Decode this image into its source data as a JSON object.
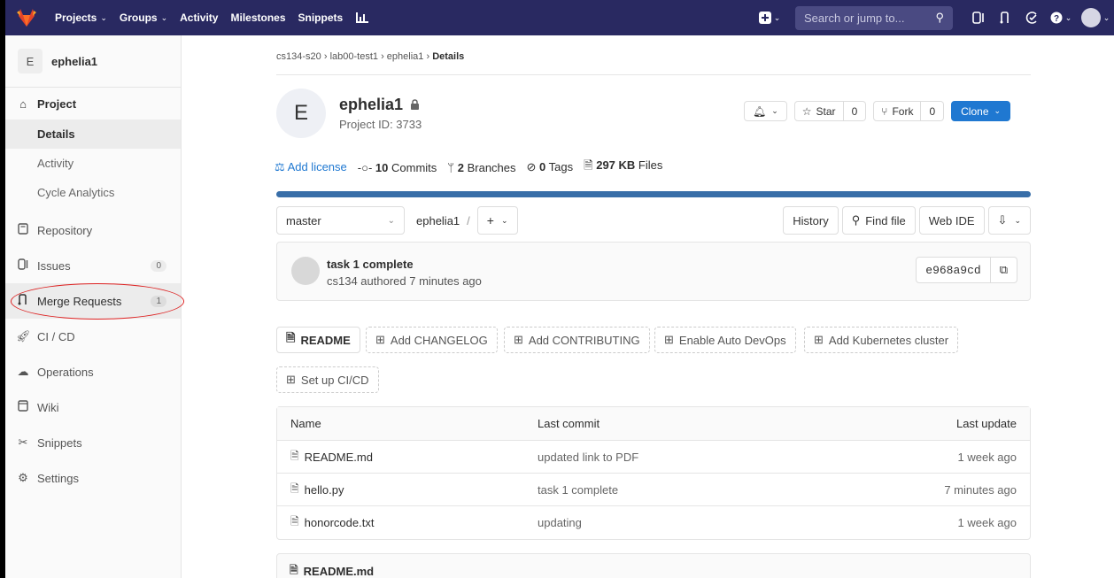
{
  "topnav": {
    "projects": "Projects",
    "groups": "Groups",
    "activity": "Activity",
    "milestones": "Milestones",
    "snippets": "Snippets",
    "search_placeholder": "Search or jump to..."
  },
  "sidebar": {
    "project_letter": "E",
    "project_name": "ephelia1",
    "project_label": "Project",
    "details": "Details",
    "activity": "Activity",
    "cycle_analytics": "Cycle Analytics",
    "repository": "Repository",
    "issues": "Issues",
    "issues_count": "0",
    "merge_requests": "Merge Requests",
    "merge_requests_count": "1",
    "cicd": "CI / CD",
    "operations": "Operations",
    "wiki": "Wiki",
    "snippets": "Snippets",
    "settings": "Settings"
  },
  "breadcrumb": {
    "group": "cs134-s20",
    "subgroup": "lab00-test1",
    "project": "ephelia1",
    "current": "Details"
  },
  "project": {
    "letter": "E",
    "name": "ephelia1",
    "id_text": "Project ID: 3733",
    "star_label": "Star",
    "star_count": "0",
    "fork_label": "Fork",
    "fork_count": "0",
    "clone_label": "Clone"
  },
  "stats": {
    "add_license": "Add license",
    "commits_count": "10",
    "commits_label": "Commits",
    "branches_count": "2",
    "branches_label": "Branches",
    "tags_count": "0",
    "tags_label": "Tags",
    "files_size": "297 KB",
    "files_label": "Files",
    "language_fill": 1.0,
    "language_color": "#386ea8"
  },
  "toolbar": {
    "branch": "master",
    "path": "ephelia1",
    "separator": "/",
    "history": "History",
    "find_file": "Find file",
    "web_ide": "Web IDE"
  },
  "last_commit": {
    "title": "task 1 complete",
    "meta": "cs134 authored 7 minutes ago",
    "sha": "e968a9cd"
  },
  "quick_actions": {
    "readme": "README",
    "changelog": "Add CHANGELOG",
    "contributing": "Add CONTRIBUTING",
    "auto_devops": "Enable Auto DevOps",
    "kubernetes": "Add Kubernetes cluster",
    "cicd": "Set up CI/CD"
  },
  "files": {
    "headers": {
      "name": "Name",
      "last_commit": "Last commit",
      "last_update": "Last update"
    },
    "rows": [
      {
        "name": "README.md",
        "commit": "updated link to PDF",
        "updated": "1 week ago"
      },
      {
        "name": "hello.py",
        "commit": "task 1 complete",
        "updated": "7 minutes ago"
      },
      {
        "name": "honorcode.txt",
        "commit": "updating",
        "updated": "1 week ago"
      }
    ]
  },
  "readme": {
    "title": "README.md"
  }
}
